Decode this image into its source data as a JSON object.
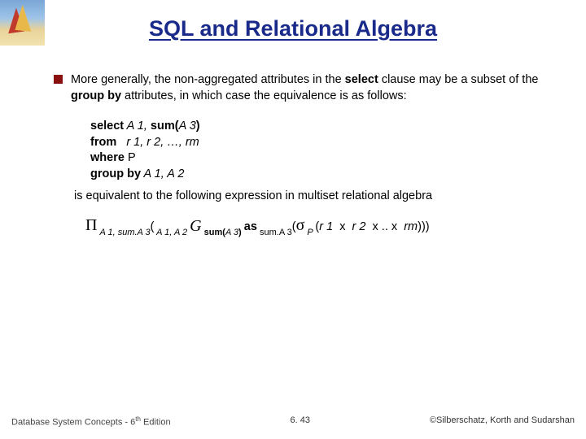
{
  "title": "SQL and Relational Algebra",
  "bullet": {
    "t1": "More generally, the non-aggregated attributes in the ",
    "bold1": "select",
    "t2": " clause may be a subset of the ",
    "bold2": "group by",
    "t3": " attributes, in which case the equivalence is as follows:"
  },
  "sql": {
    "l1_kw": "select",
    "l1_rest": " A 1, ",
    "l1_bold": "sum(",
    "l1_arg": "A 3",
    "l1_close": ")",
    "l2_kw": "from",
    "l2_rest": "   r 1, r 2, …, rm",
    "l3_kw": "where",
    "l3_rest": " P",
    "l4_kw": "group by",
    "l4_rest": " A 1, A 2"
  },
  "eq_text": "is equivalent to the following expression in multiset relational algebra",
  "expr": {
    "pi": "Π",
    "pi_sub": " A 1, sum.A 3",
    "open1": "(",
    "g_left_sub": " A 1, A 2 ",
    "G": "G",
    "g_right_sub1": " sum(",
    "g_right_arg": "A 3",
    "g_right_sub2": ") ",
    "as": "as",
    "as_after": " sum.A 3",
    "open2": "(",
    "sigma": "σ",
    "sigma_sub": " P ",
    "open3": "(",
    "r1": "r 1",
    "x1": "  x  ",
    "r2": "r 2",
    "x2": "  x .. x  ",
    "rm": "rm",
    "close": ")))"
  },
  "footer": {
    "left1": "Database System Concepts - 6",
    "left_sup": "th",
    "left2": " Edition",
    "center": "6. 43",
    "right": "©Silberschatz, Korth and Sudarshan"
  }
}
